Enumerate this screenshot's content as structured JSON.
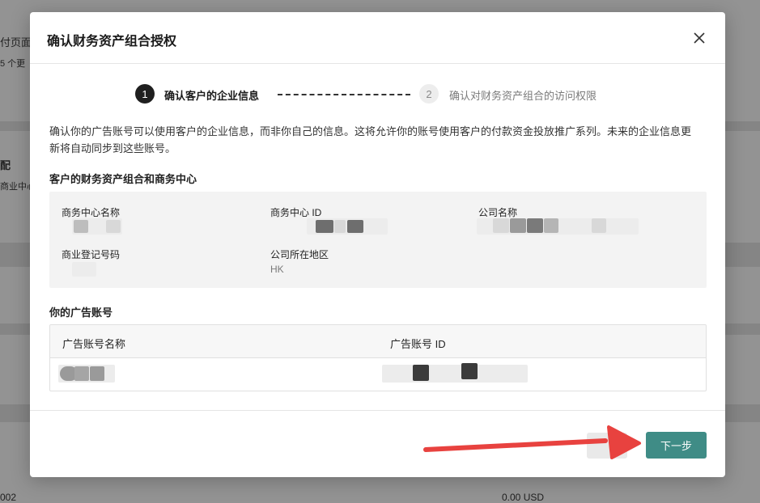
{
  "background": {
    "frag_1": "付页面",
    "frag_2": "5 个更",
    "frag_3": "配",
    "frag_4": "商业中心",
    "frag_5": "002",
    "frag_6": "0.00 USD"
  },
  "modal": {
    "title": "确认财务资产组合授权",
    "close_icon": "close-icon",
    "stepper": {
      "step1_number": "1",
      "step1_label": "确认客户的企业信息",
      "step2_number": "2",
      "step2_label": "确认对财务资产组合的访问权限"
    },
    "description": "确认你的广告账号可以使用客户的企业信息，而非你自己的信息。这将允许你的账号使用客户的付款资金投放推广系列。未来的企业信息更新将自动同步到这些账号。",
    "business_section": {
      "title": "客户的财务资产组合和商务中心",
      "fields": {
        "bc_name_label": "商务中心名称",
        "bc_id_label": "商务中心 ID",
        "company_name_label": "公司名称",
        "reg_number_label": "商业登记号码",
        "region_label": "公司所在地区",
        "region_value": "HK"
      }
    },
    "ad_accounts": {
      "title": "你的广告账号",
      "columns": [
        "广告账号名称",
        "广告账号 ID"
      ]
    },
    "footer": {
      "next_label": "下一步"
    }
  },
  "colors": {
    "primary": "#3f8c86",
    "annotation_arrow": "#e8423f"
  }
}
